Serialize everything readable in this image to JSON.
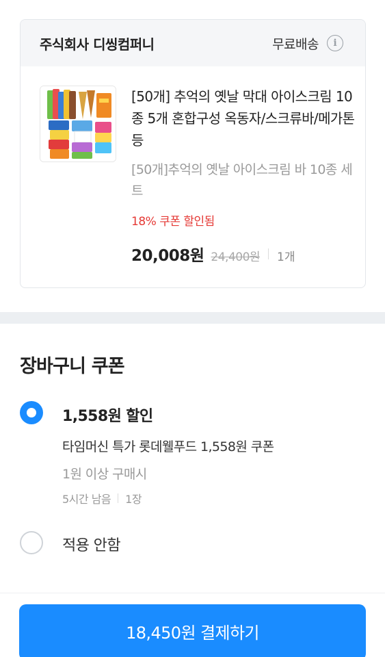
{
  "seller": {
    "name": "주식회사 디씽컴퍼니",
    "shipping_label": "무료배송",
    "info_icon": "info-circle-icon"
  },
  "product": {
    "title": "[50개] 추억의 옛날 막대 아이스크림 10종 5개 혼합구성 옥동자/스크류바/메가톤 등",
    "option": "[50개]추억의 옛날 아이스크림 바 10종 세트",
    "coupon_applied": "18% 쿠폰 할인됨",
    "final_price": "20,008원",
    "original_price": "24,400원",
    "quantity": "1개",
    "thumbnail_icon": "ice-cream-assortment-image"
  },
  "coupon_section": {
    "title": "장바구니 쿠폰",
    "options": [
      {
        "selected": true,
        "amount": "1,558원 할인",
        "name": "타임머신 특가 롯데웰푸드 1,558원 쿠폰",
        "condition": "1원 이상 구매시",
        "time_left": "5시간 남음",
        "count": "1장"
      },
      {
        "selected": false,
        "label": "적용 안함"
      }
    ]
  },
  "pay_button": {
    "label": "18,450원 결제하기"
  },
  "colors": {
    "accent": "#1a8cff",
    "discount_red": "#e53935",
    "section_gap": "#eceff2"
  }
}
